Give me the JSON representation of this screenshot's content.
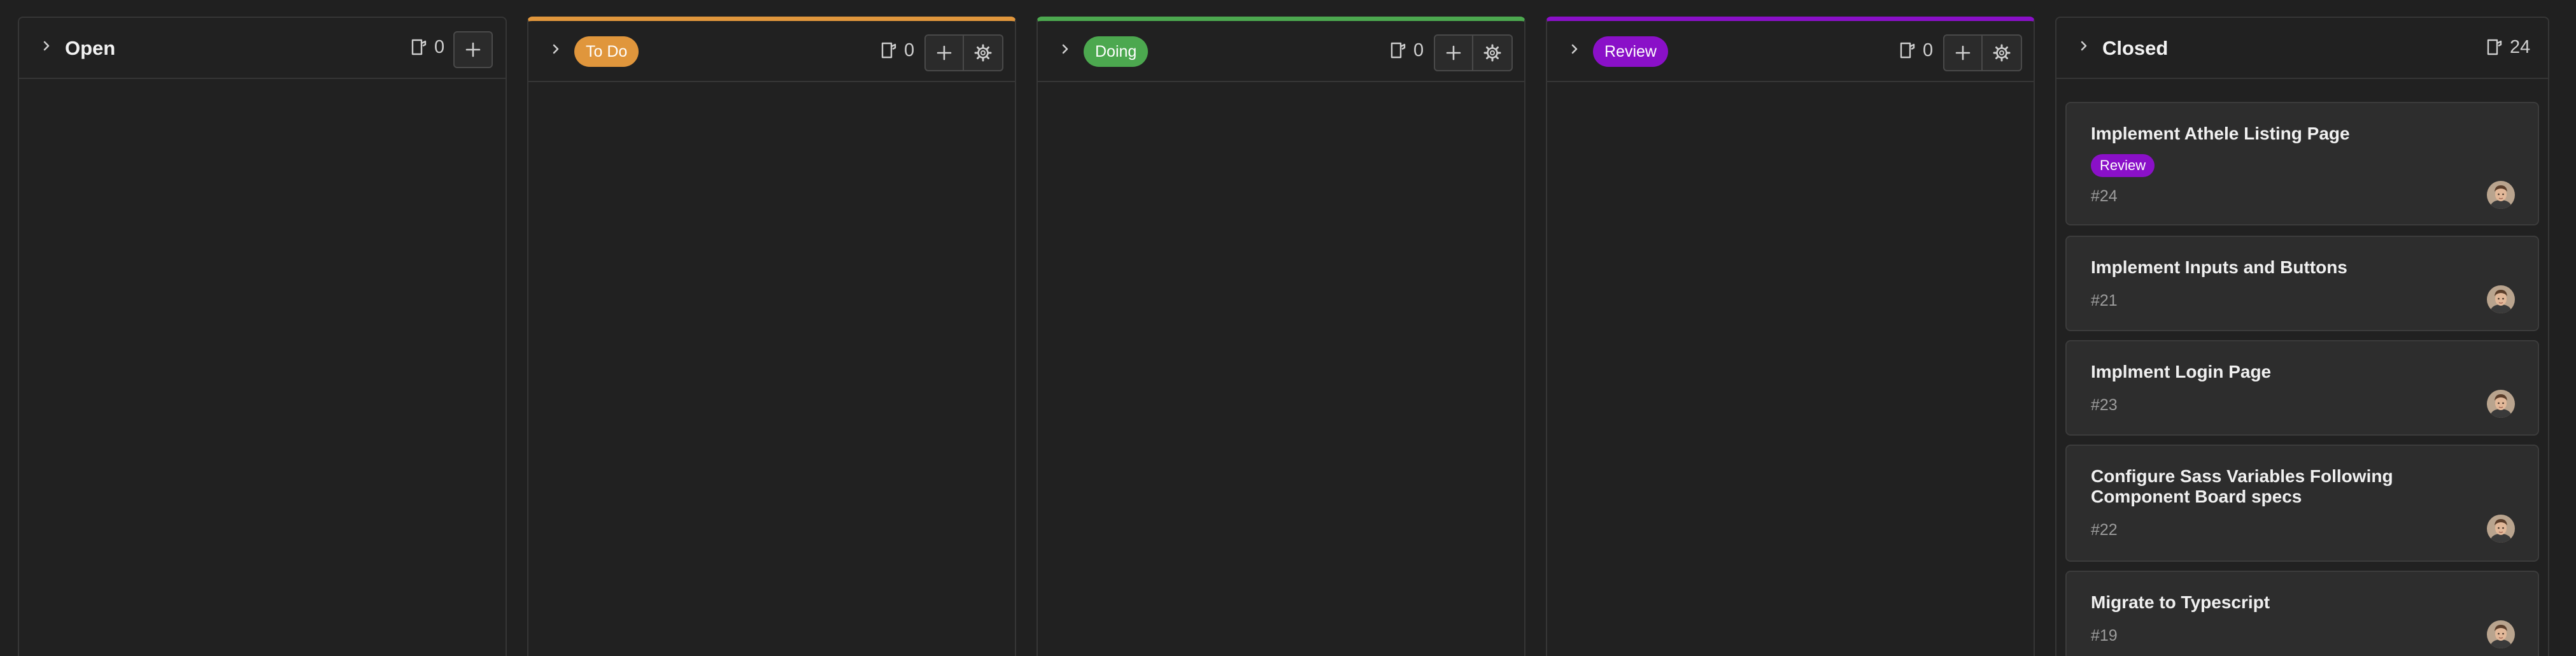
{
  "columns": [
    {
      "title": "Open",
      "count": "0"
    },
    {
      "label": "To Do",
      "count": "0",
      "color": "#e0963c"
    },
    {
      "label": "Doing",
      "count": "0",
      "color": "#4ca84f"
    },
    {
      "label": "Review",
      "count": "0",
      "color": "#8a10c8"
    },
    {
      "title": "Closed",
      "count": "24"
    }
  ],
  "closed_cards": [
    {
      "title": "Implement Athele Listing Page",
      "tag": "Review",
      "number": "#24"
    },
    {
      "title": "Implement Inputs and Buttons",
      "number": "#21"
    },
    {
      "title": "Implment Login Page",
      "number": "#23"
    },
    {
      "title": "Configure Sass Variables Following Component Board specs",
      "number": "#22"
    },
    {
      "title": "Migrate to Typescript",
      "number": "#19"
    }
  ],
  "icons": [
    "chevron-right-icon",
    "issue-icon",
    "plus-icon",
    "gear-icon",
    "avatar"
  ]
}
